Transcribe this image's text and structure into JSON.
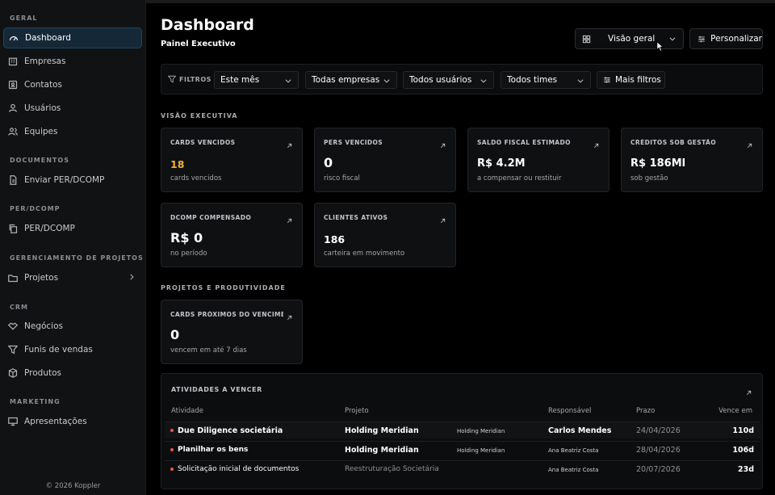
{
  "sidebar": {
    "sections": [
      {
        "title": "GERAL",
        "items": [
          {
            "label": "Dashboard",
            "icon": "gauge-icon"
          },
          {
            "label": "Empresas",
            "icon": "building-icon"
          },
          {
            "label": "Contatos",
            "icon": "contact-card-icon"
          },
          {
            "label": "Usuários",
            "icon": "user-icon"
          },
          {
            "label": "Equipes",
            "icon": "users-icon"
          }
        ]
      },
      {
        "title": "DOCUMENTOS",
        "items": [
          {
            "label": "Enviar PER/DCOMP",
            "icon": "file-upload-icon"
          }
        ]
      },
      {
        "title": "PER/DCOMP",
        "items": [
          {
            "label": "PER/DCOMP",
            "icon": "copy-icon"
          }
        ]
      },
      {
        "title": "GERENCIAMENTO DE PROJETOS",
        "items": [
          {
            "label": "Projetos",
            "icon": "folder-icon"
          }
        ]
      },
      {
        "title": "CRM",
        "items": [
          {
            "label": "Negócios",
            "icon": "handshake-icon"
          },
          {
            "label": "Funis de vendas",
            "icon": "funnel-icon"
          },
          {
            "label": "Produtos",
            "icon": "box-icon"
          }
        ]
      },
      {
        "title": "MARKETING",
        "items": [
          {
            "label": "Apresentações",
            "icon": "presentation-icon"
          }
        ]
      }
    ],
    "footer": "© 2026 Koppler"
  },
  "header": {
    "title": "Dashboard",
    "subtitle": "Painel Executivo",
    "view_select": "Visão geral",
    "customize": "Personalizar"
  },
  "filters": {
    "label": "FILTROS",
    "period": "Este mês",
    "company": "Todas empresas",
    "user": "Todos usuários",
    "team": "Todos times",
    "more": "Mais filtros"
  },
  "executive": {
    "title": "VISÃO EXECUTIVA",
    "cards": [
      {
        "label": "CARDS VENCIDOS",
        "value": "18",
        "sub": "cards vencidos"
      },
      {
        "label": "PERS VENCIDOS",
        "value": "0",
        "sub": "risco fiscal"
      },
      {
        "label": "SALDO FISCAL ESTIMADO",
        "value": "R$ 4.2M",
        "sub": "a compensar ou restituir"
      },
      {
        "label": "CRÉDITOS SOB GESTÃO",
        "value": "R$ 186Ml",
        "sub": "sob gestão"
      },
      {
        "label": "DCOMP COMPENSADO",
        "value": "R$ 0",
        "sub": "no período"
      },
      {
        "label": "CLIENTES ATIVOS",
        "value": "186",
        "sub": "carteira em movimento"
      }
    ]
  },
  "projects": {
    "title": "PROJETOS E PRODUTIVIDADE",
    "card": {
      "label": "CARDS PRÓXIMOS DO VENCIMEN...",
      "value": "0",
      "sub": "vencem em até 7 dias"
    }
  },
  "activities": {
    "title": "ATIVIDADES A VENCER",
    "columns": [
      "Atividade",
      "Projeto",
      "Responsável",
      "Prazo",
      "Vence em"
    ],
    "rows": [
      {
        "activity": "Due Diligence societária",
        "project": "Holding Meridian",
        "project_tag": "Holding Meridian",
        "owner": "Carlos Mendes",
        "deadline": "24/04/2026",
        "due_in": "110d"
      },
      {
        "activity": "Planilhar os bens",
        "project": "Holding Meridian",
        "project_tag": "Holding Meridian",
        "owner": "Ana Beatriz Costa",
        "deadline": "28/04/2026",
        "due_in": "106d"
      },
      {
        "activity": "Solicitação inicial de documentos",
        "project": "Reestruturação Societária",
        "project_tag": "",
        "owner": "Ana Beatriz Costa",
        "deadline": "20/07/2026",
        "due_in": "23d"
      }
    ]
  },
  "colors": {
    "accent": "#1f4661",
    "warning": "#f2b233",
    "danger": "#e8564a",
    "background": "#000000"
  }
}
